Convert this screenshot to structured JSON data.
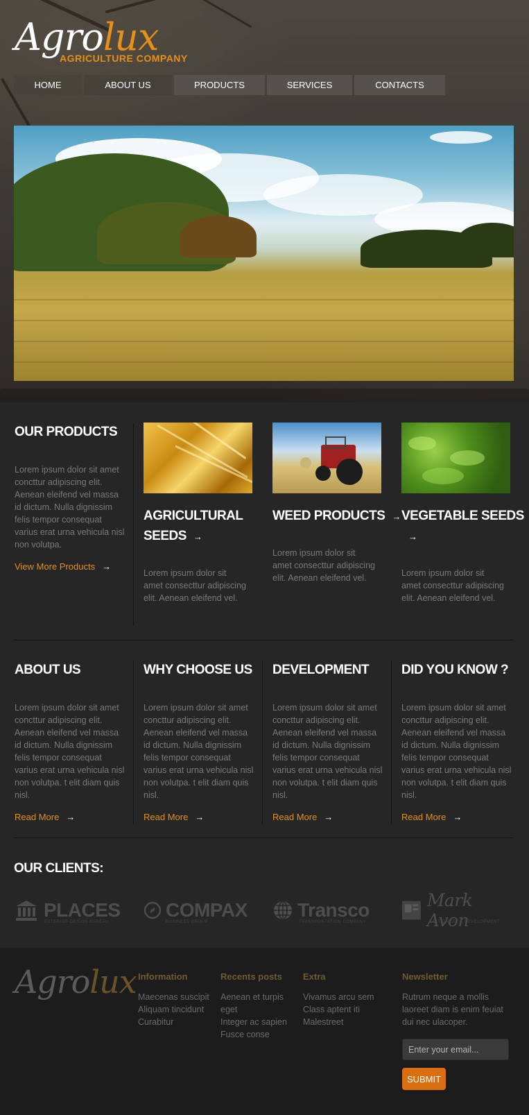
{
  "brand": {
    "logo_agro": "Agro",
    "logo_lux": "lux",
    "tagline": "AGRICULTURE COMPANY",
    "accent": "#e3901c"
  },
  "nav": {
    "items": [
      {
        "label": "HOME"
      },
      {
        "label": "ABOUT US"
      },
      {
        "label": "PRODUCTS"
      },
      {
        "label": "SERVICES"
      },
      {
        "label": "CONTACTS"
      }
    ]
  },
  "products": {
    "title": "OUR PRODUCTS",
    "text": "Lorem ipsum dolor sit amet concttur adipiscing elit. Aenean eleifend vel massa id dictum. Nulla dignissim felis tempor consequat varius erat urna vehicula nisl non volutpa.",
    "more": "View More Products",
    "arrow": "→",
    "items": [
      {
        "title_line1": "AGRICULTURAL",
        "title_line2": "SEEDS",
        "text": "Lorem ipsum dolor sit amet consecttur adipiscing elit. Aenean eleifend vel.",
        "icon": "wheat-image"
      },
      {
        "title_line1": "WEED PRODUCTS",
        "title_line2": "",
        "text": "Lorem ipsum dolor sit amet consecttur adipiscing elit. Aenean eleifend vel.",
        "icon": "tractor-image"
      },
      {
        "title_line1": "VEGETABLE SEEDS",
        "title_line2": "",
        "text": "Lorem ipsum dolor sit amet consecttur adipiscing elit. Aenean eleifend vel.",
        "icon": "tea-plants-image"
      }
    ]
  },
  "info": {
    "items": [
      {
        "title": "ABOUT US",
        "text": "Lorem ipsum dolor sit amet concttur adipiscing elit. Aenean eleifend vel massa id dictum. Nulla dignissim felis tempor consequat varius erat urna vehicula nisl non volutpa. t elit diam quis nisl.",
        "link": "Read More"
      },
      {
        "title": "WHY CHOOSE US",
        "text": "Lorem ipsum dolor sit amet concttur adipiscing elit. Aenean eleifend vel massa id dictum. Nulla dignissim felis tempor consequat varius erat urna vehicula nisl non volutpa. t elit diam quis nisl.",
        "link": "Read More"
      },
      {
        "title": "DEVELOPMENT",
        "text": "Lorem ipsum dolor sit amet concttur adipiscing elit. Aenean eleifend vel massa id dictum. Nulla dignissim felis tempor consequat varius erat urna vehicula nisl non volutpa. t elit diam quis nisl.",
        "link": "Read More"
      },
      {
        "title": "DID YOU KNOW ?",
        "text": "Lorem ipsum dolor sit amet concttur adipiscing elit. Aenean eleifend vel massa id dictum. Nulla dignissim felis tempor consequat varius erat urna vehicula nisl non volutpa. t elit diam quis nisl.",
        "link": "Read More"
      }
    ]
  },
  "clients": {
    "title": "OUR CLIENTS:",
    "items": [
      {
        "name": "PLACES",
        "sub": "EXTERIOR DESIGN BUREAU",
        "icon": "bank-icon"
      },
      {
        "name": "COMPAX",
        "sub": "BUSINESS GROUP",
        "icon": "compass-icon"
      },
      {
        "name": "Transco",
        "sub": "TRANSPORTATION COMPANY",
        "icon": "globe-icon"
      },
      {
        "name": "Mark Avon",
        "sub": "STATIONERY & DEVELOPMENT",
        "icon": "document-icon"
      }
    ]
  },
  "footer": {
    "logo_agro": "Agro",
    "logo_lux": "lux",
    "information": {
      "title": "Information",
      "items": [
        "Maecenas suscipit",
        "Aliquam tincidunt",
        "Curabitur"
      ]
    },
    "recent": {
      "title": "Recents posts",
      "items": [
        "Aenean et turpis",
        "eget",
        "Integer ac sapien",
        "Fusce conse"
      ]
    },
    "extra": {
      "title": "Extra",
      "items": [
        "Vivamus arcu sem",
        "Class aptent iti",
        "Malestreet"
      ]
    },
    "newsletter": {
      "title": "Newsletter",
      "text": "Rutrum neque a mollis laoreet diam is enim feuiat dui nec ulacoper.",
      "placeholder": "Enter your email...",
      "submit": "SUBMIT"
    }
  }
}
